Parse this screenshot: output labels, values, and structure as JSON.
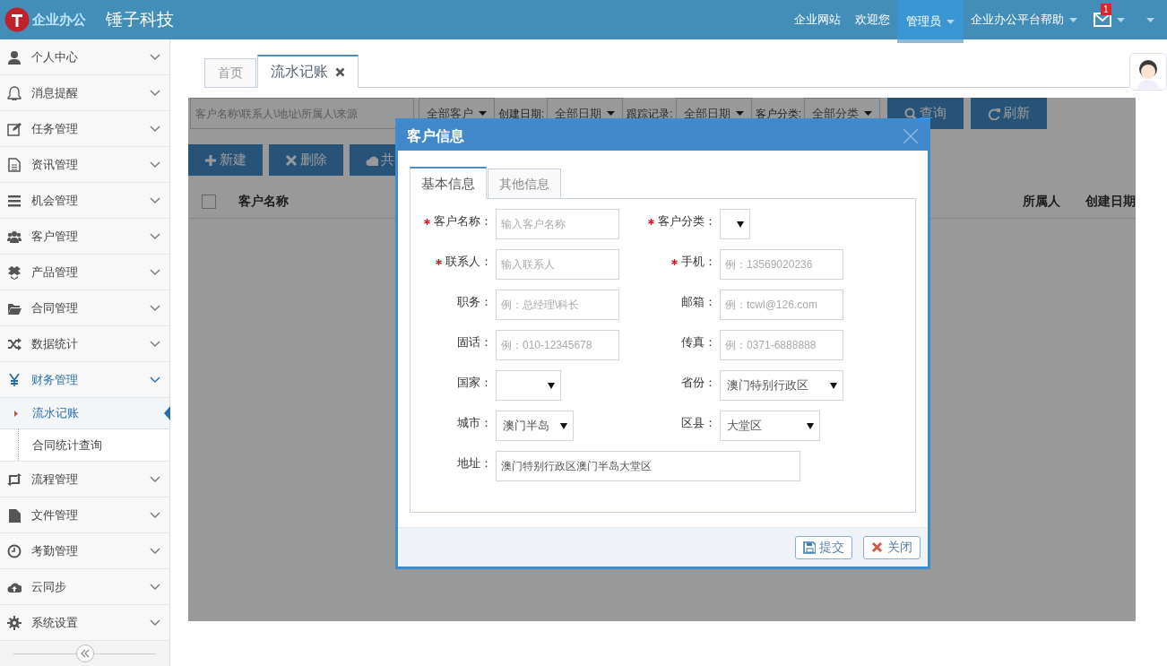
{
  "header": {
    "logo_text": "企业办公",
    "brand": "锤子科技",
    "nav": [
      {
        "label": "企业网站",
        "selected": false,
        "caret": false
      },
      {
        "label": "欢迎您",
        "selected": false,
        "caret": false
      },
      {
        "label": "管理员",
        "selected": true,
        "caret": true
      },
      {
        "label": "企业办公平台帮助",
        "selected": false,
        "caret": true
      }
    ],
    "mail_badge": "1"
  },
  "sidebar": {
    "items": [
      {
        "label": "个人中心",
        "expanded": false
      },
      {
        "label": "消息提醒",
        "expanded": false
      },
      {
        "label": "任务管理",
        "expanded": false
      },
      {
        "label": "资讯管理",
        "expanded": false
      },
      {
        "label": "机会管理",
        "expanded": false
      },
      {
        "label": "客户管理",
        "expanded": false
      },
      {
        "label": "产品管理",
        "expanded": false
      },
      {
        "label": "合同管理",
        "expanded": false
      },
      {
        "label": "数据统计",
        "expanded": false
      },
      {
        "label": "财务管理",
        "expanded": true,
        "children": [
          {
            "label": "流水记账",
            "selected": true
          },
          {
            "label": "合同统计查询",
            "selected": false
          }
        ]
      },
      {
        "label": "流程管理",
        "expanded": false
      },
      {
        "label": "文件管理",
        "expanded": false
      },
      {
        "label": "考勤管理",
        "expanded": false
      },
      {
        "label": "云同步",
        "expanded": false
      },
      {
        "label": "系统设置",
        "expanded": false
      }
    ]
  },
  "tabs": [
    {
      "label": "首页",
      "selected": false,
      "closable": false
    },
    {
      "label": "流水记账",
      "selected": true,
      "closable": true
    }
  ],
  "filters": {
    "search_placeholder": "客户名称\\联系人\\地址\\所属人\\来源",
    "items": [
      {
        "value": "全部客户"
      },
      {
        "label": "创建日期:",
        "value": "全部日期"
      },
      {
        "label": "跟踪记录:",
        "value": "全部日期"
      },
      {
        "label": "客户分类:",
        "value": "全部分类"
      }
    ],
    "buttons": [
      {
        "label": "查询",
        "kind": "search"
      },
      {
        "label": "刷新",
        "kind": "refresh"
      }
    ]
  },
  "toolbar": [
    {
      "label": "新建",
      "kind": "add"
    },
    {
      "label": "删除",
      "kind": "delete"
    },
    {
      "label": "共",
      "kind": "cloud"
    }
  ],
  "table": {
    "select_all_checked": false,
    "columns": [
      "客户名称",
      "所属人",
      "创建日期"
    ]
  },
  "modal": {
    "title": "客户信息",
    "tabs": [
      {
        "label": "基本信息",
        "selected": true
      },
      {
        "label": "其他信息",
        "selected": false
      }
    ],
    "rows": [
      [
        {
          "label": "客户名称：",
          "required": true,
          "kind": "input",
          "placeholder": "输入客户名称"
        },
        {
          "label": "客户分类：",
          "required": true,
          "kind": "select"
        }
      ],
      [
        {
          "label": "联系人：",
          "required": true,
          "kind": "input",
          "placeholder": "输入联系人"
        },
        {
          "label": "手机：",
          "required": true,
          "kind": "input",
          "placeholder": "例：13569020236"
        }
      ],
      [
        {
          "label": "职务：",
          "required": false,
          "kind": "input",
          "placeholder": "例：总经理\\科长"
        },
        {
          "label": "邮箱：",
          "required": false,
          "kind": "input",
          "placeholder": "例：tcwl@126.com"
        }
      ],
      [
        {
          "label": "固话：",
          "required": false,
          "kind": "input",
          "placeholder": "例：010-12345678"
        },
        {
          "label": "传真：",
          "required": false,
          "kind": "input",
          "placeholder": "例：0371-6888888"
        }
      ],
      [
        {
          "label": "国家：",
          "required": false,
          "kind": "select"
        },
        {
          "label": "省份：",
          "required": false,
          "kind": "select",
          "value": "澳门特别行政区"
        }
      ],
      [
        {
          "label": "城市：",
          "required": false,
          "kind": "select",
          "value": "澳门半岛"
        },
        {
          "label": "区县：",
          "required": false,
          "kind": "select",
          "value": "大堂区"
        }
      ],
      [
        {
          "label": "地址：",
          "required": false,
          "kind": "input",
          "value": "澳门特别行政区澳门半岛大堂区"
        }
      ]
    ],
    "buttons": [
      {
        "label": "提交",
        "kind": "save"
      },
      {
        "label": "关闭",
        "kind": "close"
      }
    ]
  }
}
